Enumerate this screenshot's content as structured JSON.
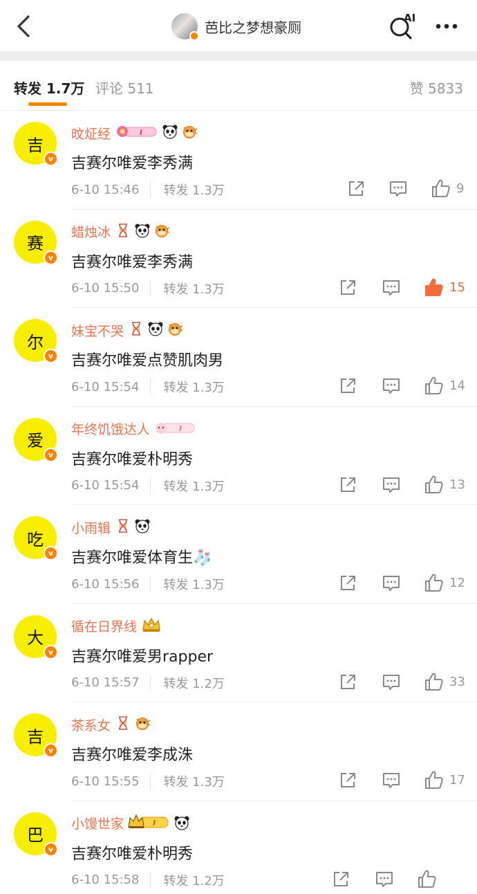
{
  "header": {
    "title": "芭比之梦想豪厕",
    "ai_label": "AI"
  },
  "tabs": {
    "repost": "转发 1.7万",
    "comment": "评论 511",
    "like": "赞 5833"
  },
  "colors": {
    "accent": "#ff8200",
    "username": "#eb7350",
    "avatar_bg": "#f7ee00",
    "liked": "#f26d3d"
  },
  "items": [
    {
      "avatar_char": "吉",
      "username": "旼炡经",
      "badges": [
        "flower-pink-tag",
        "panda",
        "pufferfish"
      ],
      "text": "吉赛尔唯爱李秀满",
      "time": "6-10 15:46",
      "reposts": "转发 1.3万",
      "likes": "9",
      "liked": false
    },
    {
      "avatar_char": "赛",
      "username": "蜡烛冰",
      "badges": [
        "hourglass",
        "panda",
        "pufferfish"
      ],
      "text": "吉赛尔唯爱李秀满",
      "time": "6-10 15:50",
      "reposts": "转发 1.3万",
      "likes": "15",
      "liked": true
    },
    {
      "avatar_char": "尔",
      "username": "妹宝不哭",
      "badges": [
        "hourglass",
        "panda",
        "pufferfish"
      ],
      "text": "吉赛尔唯爱点赞肌肉男",
      "time": "6-10 15:54",
      "reposts": "转发 1.3万",
      "likes": "14",
      "liked": false
    },
    {
      "avatar_char": "爱",
      "username": "年终饥饿达人",
      "badges": [
        "pink-cat-tag"
      ],
      "text": "吉赛尔唯爱朴明秀",
      "time": "6-10 15:54",
      "reposts": "转发 1.3万",
      "likes": "13",
      "liked": false
    },
    {
      "avatar_char": "吃",
      "username": "小雨辑",
      "badges": [
        "hourglass",
        "panda"
      ],
      "text": "吉赛尔唯爱体育生🧦",
      "time": "6-10 15:56",
      "reposts": "转发 1.3万",
      "likes": "12",
      "liked": false
    },
    {
      "avatar_char": "大",
      "username": "循在日界线",
      "badges": [
        "crown-gold"
      ],
      "text": "吉赛尔唯爱男rapper",
      "time": "6-10 15:57",
      "reposts": "转发 1.2万",
      "likes": "33",
      "liked": false
    },
    {
      "avatar_char": "吉",
      "username": "茶系女",
      "badges": [
        "hourglass",
        "pufferfish"
      ],
      "text": "吉赛尔唯爱李成洙",
      "time": "6-10 15:55",
      "reposts": "转发 1.3万",
      "likes": "17",
      "liked": false
    },
    {
      "avatar_char": "巴",
      "username": "小馒世家",
      "badges": [
        "crown-tag",
        "panda"
      ],
      "text": "吉赛尔唯爱朴明秀",
      "time": "6-10 15:58",
      "reposts": "转发 1.2万",
      "likes": "",
      "liked": false
    }
  ]
}
